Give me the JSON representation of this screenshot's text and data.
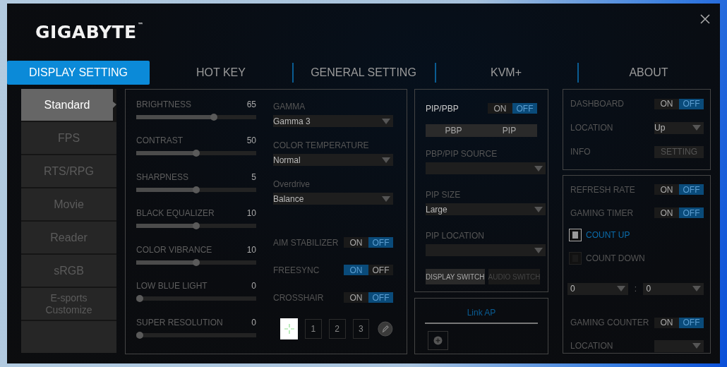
{
  "logo": {
    "text": "GIGABYTE",
    "mark": "™"
  },
  "tabs": [
    {
      "label": "DISPLAY SETTING",
      "selected": true
    },
    {
      "label": "HOT KEY",
      "selected": false
    },
    {
      "label": "GENERAL SETTING",
      "selected": false
    },
    {
      "label": "KVM+",
      "selected": false
    },
    {
      "label": "ABOUT",
      "selected": false
    }
  ],
  "presets": [
    {
      "label": "Standard",
      "selected": true
    },
    {
      "label": "FPS",
      "selected": false
    },
    {
      "label": "RTS/RPG",
      "selected": false
    },
    {
      "label": "Movie",
      "selected": false
    },
    {
      "label": "Reader",
      "selected": false
    },
    {
      "label": "sRGB",
      "selected": false
    },
    {
      "label": "E-sports Customize",
      "selected": false
    }
  ],
  "sliders": [
    {
      "label": "BRIGHTNESS",
      "value": "65",
      "level": 0.65
    },
    {
      "label": "CONTRAST",
      "value": "50",
      "level": 0.5
    },
    {
      "label": "SHARPNESS",
      "value": "5",
      "level": 0.5
    },
    {
      "label": "BLACK EQUALIZER",
      "value": "10",
      "level": 0.5
    },
    {
      "label": "COLOR VIBRANCE",
      "value": "10",
      "level": 0.5
    },
    {
      "label": "LOW BLUE LIGHT",
      "value": "0",
      "level": 0
    },
    {
      "label": "SUPER RESOLUTION",
      "value": "0",
      "level": 0
    }
  ],
  "dropdowns": [
    {
      "label": "GAMMA",
      "value": "Gamma 3"
    },
    {
      "label": "COLOR TEMPERATURE",
      "value": "Normal"
    },
    {
      "label": "Overdrive",
      "value": "Balance"
    }
  ],
  "toggles": [
    {
      "label": "AIM STABILIZER",
      "on": false,
      "on_text": "ON",
      "off_text": "OFF"
    },
    {
      "label": "FREESYNC",
      "on": true,
      "on_text": "ON",
      "off_text": "OFF"
    },
    {
      "label": "CROSSHAIR",
      "on": false,
      "on_text": "ON",
      "off_text": "OFF"
    }
  ],
  "crosshair_slots": [
    {
      "label": "1",
      "selected": false
    },
    {
      "label": "2",
      "selected": false
    },
    {
      "label": "3",
      "selected": false
    }
  ],
  "pip": {
    "toggle": {
      "label": "PIP/PBP",
      "on": false,
      "on_text": "ON",
      "off_text": "OFF"
    },
    "modes": [
      "PBP",
      "PIP"
    ],
    "dropdowns": [
      {
        "label": "PBP/PIP SOURCE"
      },
      {
        "label": "PIP SIZE",
        "value": "Large"
      },
      {
        "label": "PIP LOCATION"
      }
    ],
    "switches": [
      {
        "label": "DISPLAY SWITCH",
        "disabled": false
      },
      {
        "label": "AUDIO SWITCH",
        "disabled": true
      }
    ]
  },
  "link_ap": {
    "title": "Link AP"
  },
  "dashboard": {
    "toggle": {
      "label": "DASHBOARD",
      "on": false,
      "on_text": "ON",
      "off_text": "OFF"
    },
    "location": {
      "label": "LOCATION",
      "value": "Up"
    },
    "info": {
      "label": "INFO",
      "button": "SETTING",
      "disabled": true
    }
  },
  "timer": {
    "refresh": {
      "label": "REFRESH RATE",
      "on": false,
      "on_text": "ON",
      "off_text": "OFF"
    },
    "gaming_timer": {
      "label": "GAMING TIMER",
      "on": false,
      "on_text": "ON",
      "off_text": "OFF"
    },
    "modes": [
      {
        "label": "COUNT UP",
        "selected": true
      },
      {
        "label": "COUNT DOWN",
        "selected": false
      }
    ],
    "minutes": "0",
    "separator": ":",
    "seconds": "0",
    "counter": {
      "label": "GAMING COUNTER",
      "on": false,
      "on_text": "ON",
      "off_text": "OFF"
    },
    "location": {
      "label": "LOCATION"
    }
  }
}
